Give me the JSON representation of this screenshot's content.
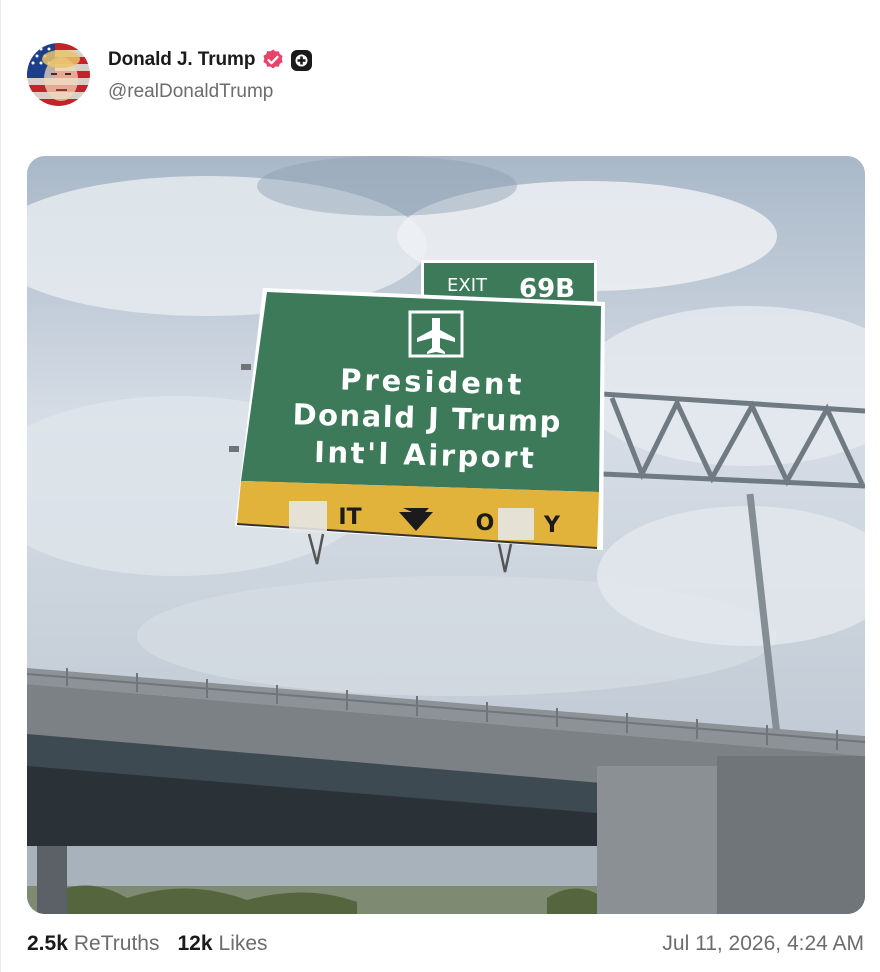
{
  "post": {
    "author": {
      "display_name": "Donald J. Trump",
      "handle": "@realDonaldTrump"
    },
    "image": {
      "sign": {
        "exit_tab": {
          "label": "EXIT",
          "number": "69B"
        },
        "line1": "President",
        "line2": "Donald J Trump",
        "line3": "Int'l Airport",
        "lane_left": "IT",
        "lane_right_a": "O",
        "lane_right_b": "Y"
      }
    },
    "stats": {
      "retruths_count": "2.5k",
      "retruths_label": "ReTruths",
      "likes_count": "12k",
      "likes_label": "Likes"
    },
    "timestamp": "Jul 11, 2026, 4:24 AM"
  },
  "colors": {
    "verified_badge": "#e8436a",
    "sign_green": "#3c7a5a",
    "sign_yellow": "#e2b33a"
  },
  "icons": {
    "verified": "verified-badge-icon",
    "plus": "plus-badge-icon",
    "airplane": "airplane-icon",
    "down_arrow": "down-arrow-icon"
  }
}
